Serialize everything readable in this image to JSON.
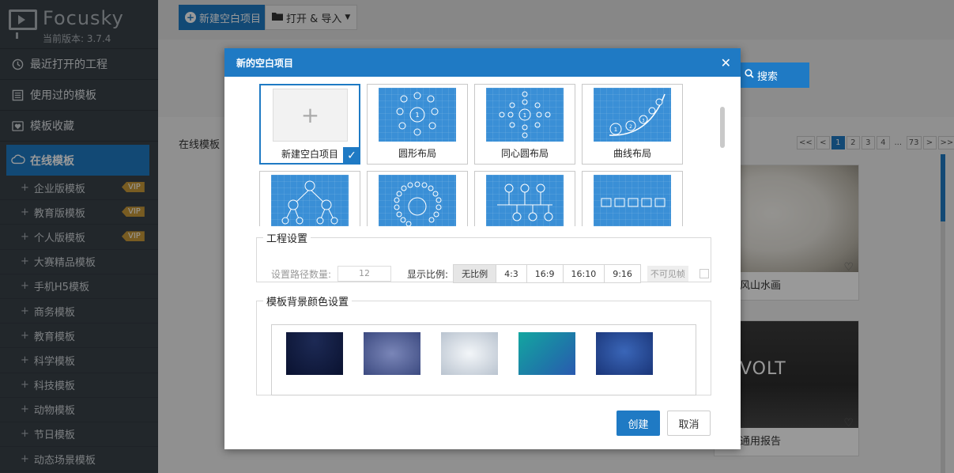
{
  "app": {
    "name": "Focusky",
    "version": "当前版本: 3.7.4"
  },
  "sidebar": {
    "top_items": [
      {
        "label": "最近打开的工程",
        "icon": "clock-icon"
      },
      {
        "label": "使用过的模板",
        "icon": "list-icon"
      },
      {
        "label": "模板收藏",
        "icon": "heart-icon"
      }
    ],
    "active": {
      "label": "在线模板",
      "icon": "cloud-icon"
    },
    "sub_items": [
      {
        "label": "企业版模板",
        "vip": "VIP"
      },
      {
        "label": "教育版模板",
        "vip": "VIP"
      },
      {
        "label": "个人版模板",
        "vip": "VIP"
      },
      {
        "label": "大赛精品模板",
        "vip": ""
      },
      {
        "label": "手机H5模板",
        "vip": ""
      },
      {
        "label": "商务模板",
        "vip": ""
      },
      {
        "label": "教育模板",
        "vip": ""
      },
      {
        "label": "科学模板",
        "vip": ""
      },
      {
        "label": "科技模板",
        "vip": ""
      },
      {
        "label": "动物模板",
        "vip": ""
      },
      {
        "label": "节日模板",
        "vip": ""
      },
      {
        "label": "动态场景模板",
        "vip": ""
      }
    ]
  },
  "toolbar": {
    "new_label": "新建空白项目",
    "open_label": "打开 & 导入"
  },
  "search": {
    "button_label": "搜索"
  },
  "main": {
    "section_title": "在线模板",
    "pager": [
      "<<",
      "<",
      "1",
      "2",
      "3",
      "4",
      "...",
      "73",
      ">",
      ">>"
    ],
    "active_page": "1",
    "cards": [
      {
        "label": "风山水画"
      },
      {
        "label": "通用报告",
        "thumb_text": "VOLT"
      }
    ]
  },
  "modal": {
    "title": "新的空白项目",
    "tiles": [
      {
        "label": "新建空白项目",
        "kind": "blank",
        "selected": true
      },
      {
        "label": "圆形布局",
        "kind": "circle"
      },
      {
        "label": "同心圆布局",
        "kind": "concentric"
      },
      {
        "label": "曲线布局",
        "kind": "curve"
      },
      {
        "label": "",
        "kind": "tree"
      },
      {
        "label": "",
        "kind": "ring"
      },
      {
        "label": "",
        "kind": "timeline"
      },
      {
        "label": "",
        "kind": "brackets"
      }
    ],
    "project_settings": {
      "legend": "工程设置",
      "path_count_label": "设置路径数量:",
      "path_count_value": "12",
      "ratio_label": "显示比例:",
      "ratios": [
        "无比例",
        "4:3",
        "16:9",
        "16:10",
        "9:16"
      ],
      "selected_ratio": "无比例",
      "invisible_frame_label": "不可见帧"
    },
    "bg_settings": {
      "legend": "模板背景颜色设置",
      "swatches": [
        "#0f1a3a",
        "#4a5a8f",
        "#d5dde6",
        "#1a9aa0",
        "#2a4f9a"
      ]
    },
    "create_label": "创建",
    "cancel_label": "取消"
  },
  "colors": {
    "accent": "#1f7ac4",
    "sidebar_bg": "#394149"
  }
}
